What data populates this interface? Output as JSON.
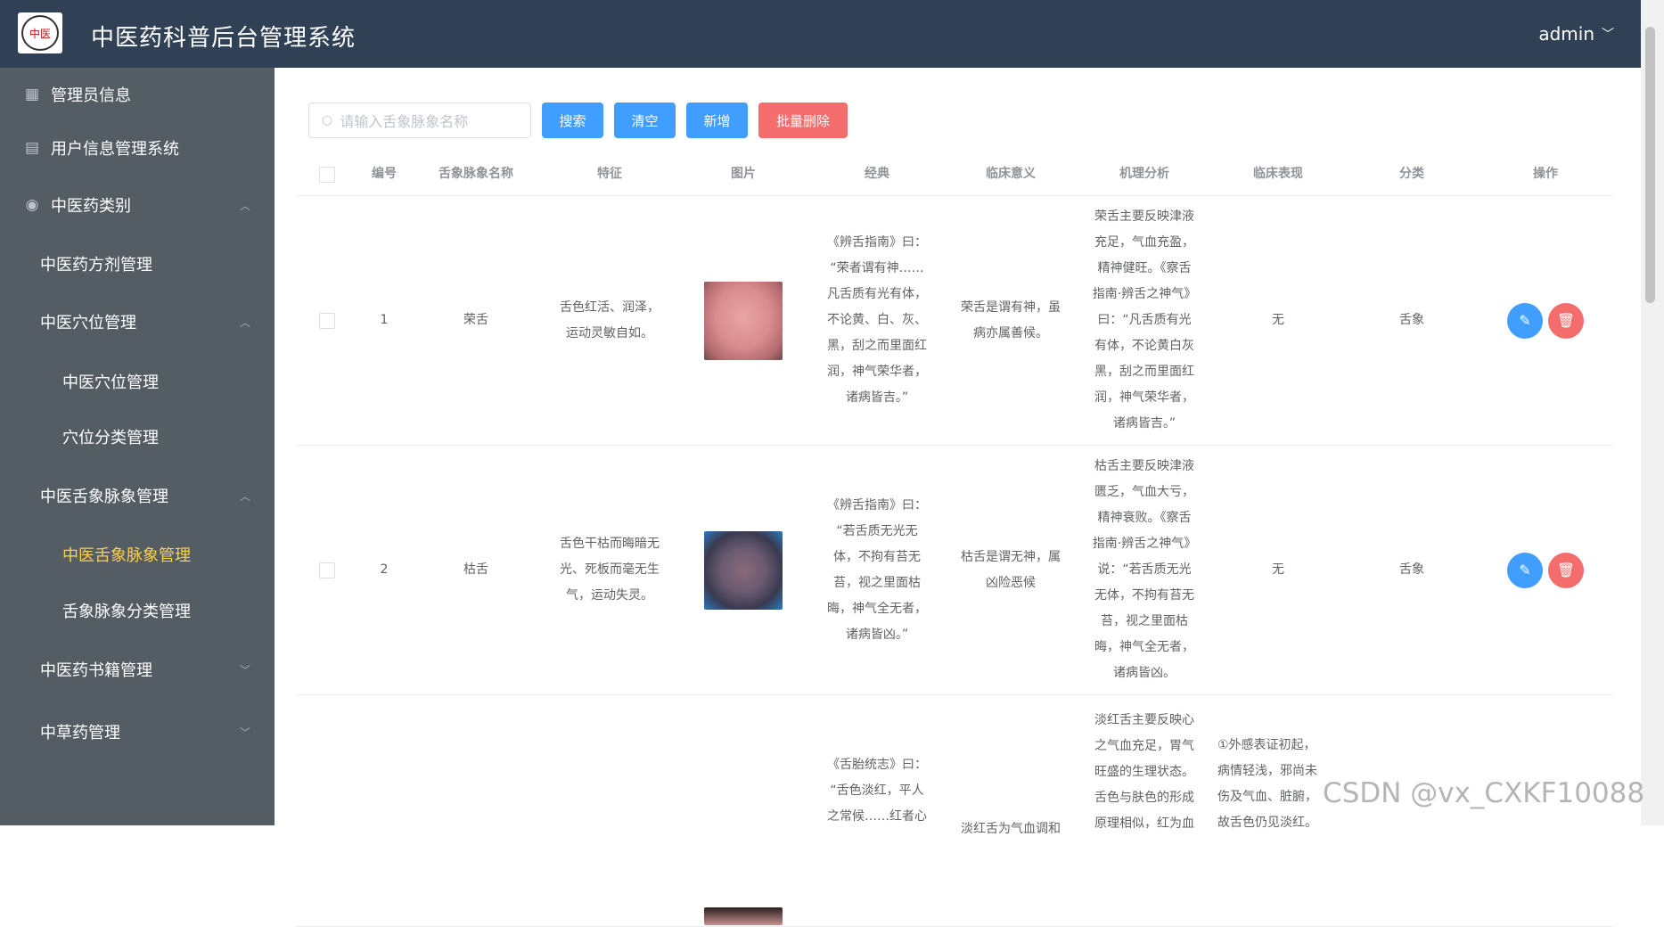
{
  "header": {
    "logo_text": "中医",
    "title": "中医药科普后台管理系统",
    "user": "admin"
  },
  "sidebar": {
    "items": [
      {
        "label": "管理员信息",
        "icon": "grid-icon"
      },
      {
        "label": "用户信息管理系统",
        "icon": "document-icon"
      },
      {
        "label": "中医药类别",
        "icon": "location-icon",
        "expanded": true
      },
      {
        "label": "中医药方剂管理"
      },
      {
        "label": "中医穴位管理",
        "expanded": true
      },
      {
        "label": "中医穴位管理"
      },
      {
        "label": "穴位分类管理"
      },
      {
        "label": "中医舌象脉象管理",
        "expanded": true
      },
      {
        "label": "中医舌象脉象管理",
        "active": true
      },
      {
        "label": "舌象脉象分类管理"
      },
      {
        "label": "中医药书籍管理",
        "expanded": false
      },
      {
        "label": "中草药管理",
        "expanded": false
      }
    ]
  },
  "toolbar": {
    "search_placeholder": "请输入舌象脉象名称",
    "search_label": "搜索",
    "clear_label": "清空",
    "add_label": "新增",
    "batch_delete_label": "批量删除"
  },
  "table": {
    "columns": [
      "编号",
      "舌象脉象名称",
      "特征",
      "图片",
      "经典",
      "临床意义",
      "机理分析",
      "临床表现",
      "分类",
      "操作"
    ],
    "rows": [
      {
        "id": "1",
        "name": "荣舌",
        "feature": [
          "舌色红活、润泽，",
          "运动灵敏自如。"
        ],
        "classic": [
          "《辨舌指南》曰：",
          "“荣者谓有神……",
          "凡舌质有光有体，",
          "不论黄、白、灰、",
          "黑，刮之而里面红",
          "润，神气荣华者，",
          "诸病皆吉。”"
        ],
        "meaning": [
          "荣舌是谓有神，虽",
          "病亦属善候。"
        ],
        "mechanism": [
          "荣舌主要反映津液",
          "充足，气血充盈，",
          "精神健旺。《察舌",
          "指南·辨舌之神气》",
          "曰：“凡舌质有光",
          "有体，不论黄白灰",
          "黑，刮之而里面红",
          "润，神气荣华者，",
          "诸病皆吉。”"
        ],
        "clinical": [
          "无"
        ],
        "category": "舌象"
      },
      {
        "id": "2",
        "name": "枯舌",
        "feature": [
          "舌色干枯而晦暗无",
          "光、死板而毫无生",
          "气，运动失灵。"
        ],
        "classic": [
          "《辨舌指南》曰：",
          "“若舌质无光无",
          "体，不拘有苔无",
          "苔，视之里面枯",
          "晦，神气全无者，",
          "诸病皆凶。”"
        ],
        "meaning": [
          "枯舌是谓无神，属",
          "凶险恶候"
        ],
        "mechanism": [
          "枯舌主要反映津液",
          "匮乏，气血大亏，",
          "精神衰败。《察舌",
          "指南·辨舌之神气》",
          "说：“若舌质无光",
          "无体，不拘有苔无",
          "苔，视之里面枯",
          "晦，神气全无者，",
          "诸病皆凶。"
        ],
        "clinical": [
          "无"
        ],
        "category": "舌象"
      },
      {
        "id": "",
        "name": "",
        "feature": [],
        "classic": [
          "《舌胎统志》曰：",
          "“舌色淡红，平人",
          "之常候……红者心"
        ],
        "meaning": [
          "淡红舌为气血调和"
        ],
        "mechanism": [
          "淡红舌主要反映心",
          "之气血充足，胃气",
          "旺盛的生理状态。",
          "舌色与肤色的形成",
          "原理相似，红为血"
        ],
        "clinical": [
          "①外感表证初起，",
          "病情轻浅，邪尚未",
          "伤及气血、脏腑，",
          "故舌色仍见淡红。"
        ],
        "category": ""
      }
    ]
  },
  "watermark": "CSDN @vx_CXKF10088"
}
